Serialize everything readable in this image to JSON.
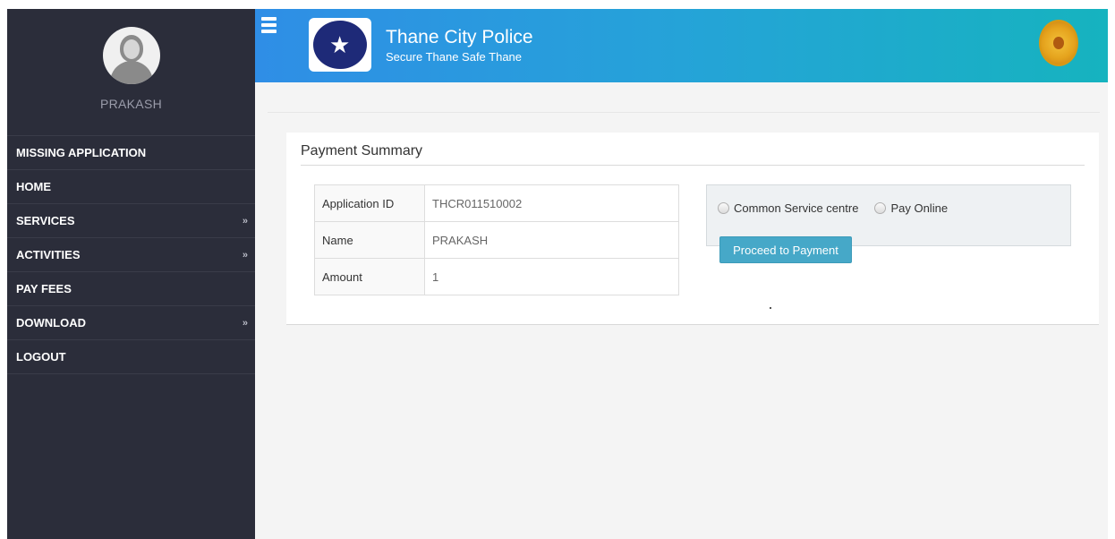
{
  "sidebar": {
    "username": "PRAKASH",
    "items": [
      {
        "label": "MISSING APPLICATION",
        "expandable": false
      },
      {
        "label": "HOME",
        "expandable": false
      },
      {
        "label": "SERVICES",
        "expandable": true
      },
      {
        "label": "ACTIVITIES",
        "expandable": true
      },
      {
        "label": "PAY FEES",
        "expandable": false
      },
      {
        "label": "DOWNLOAD",
        "expandable": true
      },
      {
        "label": "LOGOUT",
        "expandable": false
      }
    ],
    "chevron": "»"
  },
  "header": {
    "title": "Thane City Police",
    "subtitle": "Secure Thane Safe Thane",
    "gradient_start": "#2f8ee6",
    "gradient_end": "#16b3bf"
  },
  "payment": {
    "heading": "Payment Summary",
    "rows": [
      {
        "label": "Application ID",
        "value": "THCR011510002"
      },
      {
        "label": "Name",
        "value": "PRAKASH"
      },
      {
        "label": "Amount",
        "value": "1"
      }
    ],
    "options": [
      "Common Service centre",
      "Pay Online"
    ],
    "proceed_label": "Proceed to Payment",
    "button_color": "#46a8c8"
  },
  "icons": {
    "menu": "hamburger-icon",
    "logo": "police-logo",
    "emblem": "maharashtra-emblem",
    "chevron": "double-chevron-down-icon"
  }
}
